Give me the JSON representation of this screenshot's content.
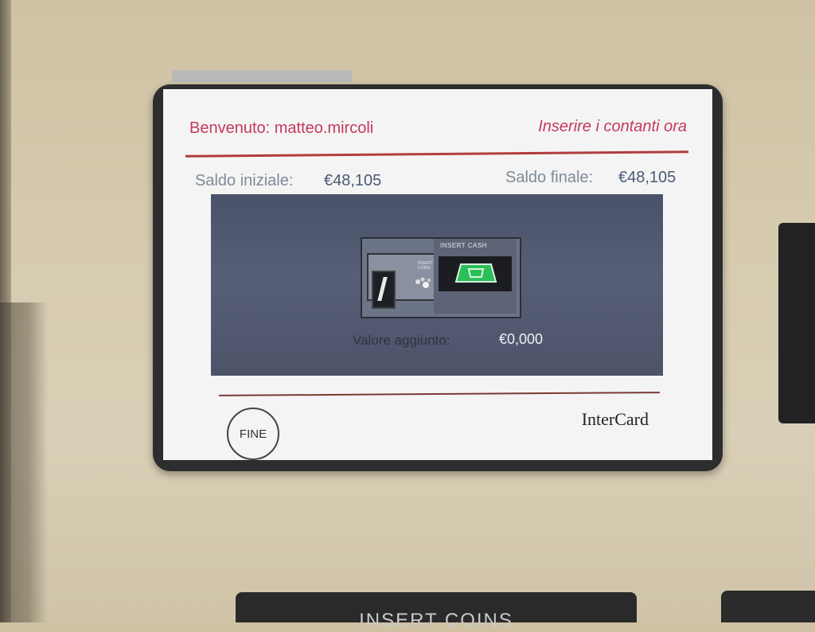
{
  "header": {
    "welcome": "Benvenuto: matteo.mircoli",
    "prompt": "Inserire i contanti ora"
  },
  "balances": {
    "initial_label": "Saldo iniziale:",
    "initial_value": "€48,105",
    "final_label": "Saldo finale:",
    "final_value": "€48,105"
  },
  "insert_widget": {
    "coin_text": "INSERT COINS",
    "cash_label": "INSERT CASH",
    "icons": [
      "coin-slot-icon",
      "coins-icon",
      "cash-slot-icon",
      "banknote-icon"
    ]
  },
  "added": {
    "label": "Valore aggiunto:",
    "value": "€0,000"
  },
  "footer": {
    "fine_label": "FINE",
    "brand": "InterCard"
  },
  "machine": {
    "coin_plate_text": "INSERT COINS"
  },
  "colors": {
    "accent": "#c43a5c",
    "panel": "#545c73",
    "rule": "#b13d3d"
  }
}
